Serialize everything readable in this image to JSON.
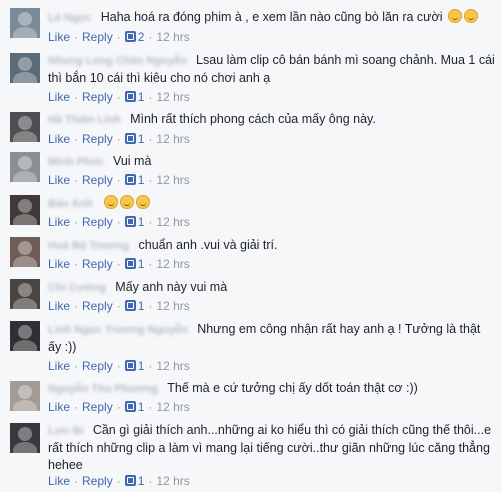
{
  "actions": {
    "like": "Like",
    "reply": "Reply",
    "sep": "·"
  },
  "comments": [
    {
      "name": "Lê Ngọc",
      "text": "Haha hoá ra đóng phim à , e xem lần nào cũng bò lăn ra cười",
      "likes": "2",
      "time": "12 hrs",
      "emoji_count": 2
    },
    {
      "name": "Nhung Long Chân Nguyễn",
      "text": "Lsau làm clip cô bán bánh mì soang chảnh. Mua 1 cái thì bắn 10 cái thì kiêu cho nó chơi anh ạ",
      "likes": "1",
      "time": "12 hrs",
      "emoji_count": 0
    },
    {
      "name": "Hà Thiên Linh",
      "text": "Mình rất thích phong cách của mấy ông này.",
      "likes": "1",
      "time": "12 hrs",
      "emoji_count": 0
    },
    {
      "name": "Minh Phúc",
      "text": "Vui mà",
      "likes": "1",
      "time": "12 hrs",
      "emoji_count": 0
    },
    {
      "name": "Bảo Anh",
      "text": "",
      "likes": "1",
      "time": "12 hrs",
      "emoji_count": 3
    },
    {
      "name": "Hoà Bộ Trương",
      "text": "chuẩn anh .vui và giải trí.",
      "likes": "1",
      "time": "12 hrs",
      "emoji_count": 0
    },
    {
      "name": "Chi Cường",
      "text": "Mấy anh này vui mà",
      "likes": "1",
      "time": "12 hrs",
      "emoji_count": 0
    },
    {
      "name": "Linh Ngọc Trương Nguyễn",
      "text": "Nhưng em công nhận rất hay anh ạ ! Tưởng là thật ấy :))",
      "likes": "1",
      "time": "12 hrs",
      "emoji_count": 0
    },
    {
      "name": "Nguyễn Thu Phương",
      "text": "Thế mà e cứ tưởng chị ấy dốt toán thật cơ :))",
      "likes": "1",
      "time": "12 hrs",
      "emoji_count": 0
    },
    {
      "name": "Lưu Bí",
      "text": "Cần gì giải thích anh...những ai ko hiểu thì có giải thích cũng thế thôi...e rất thích những clip a làm vì mang lại tiếng cười..thư giãn những lúc căng thẳng hehee",
      "likes": "1",
      "time": "12 hrs",
      "emoji_count": 0
    }
  ]
}
